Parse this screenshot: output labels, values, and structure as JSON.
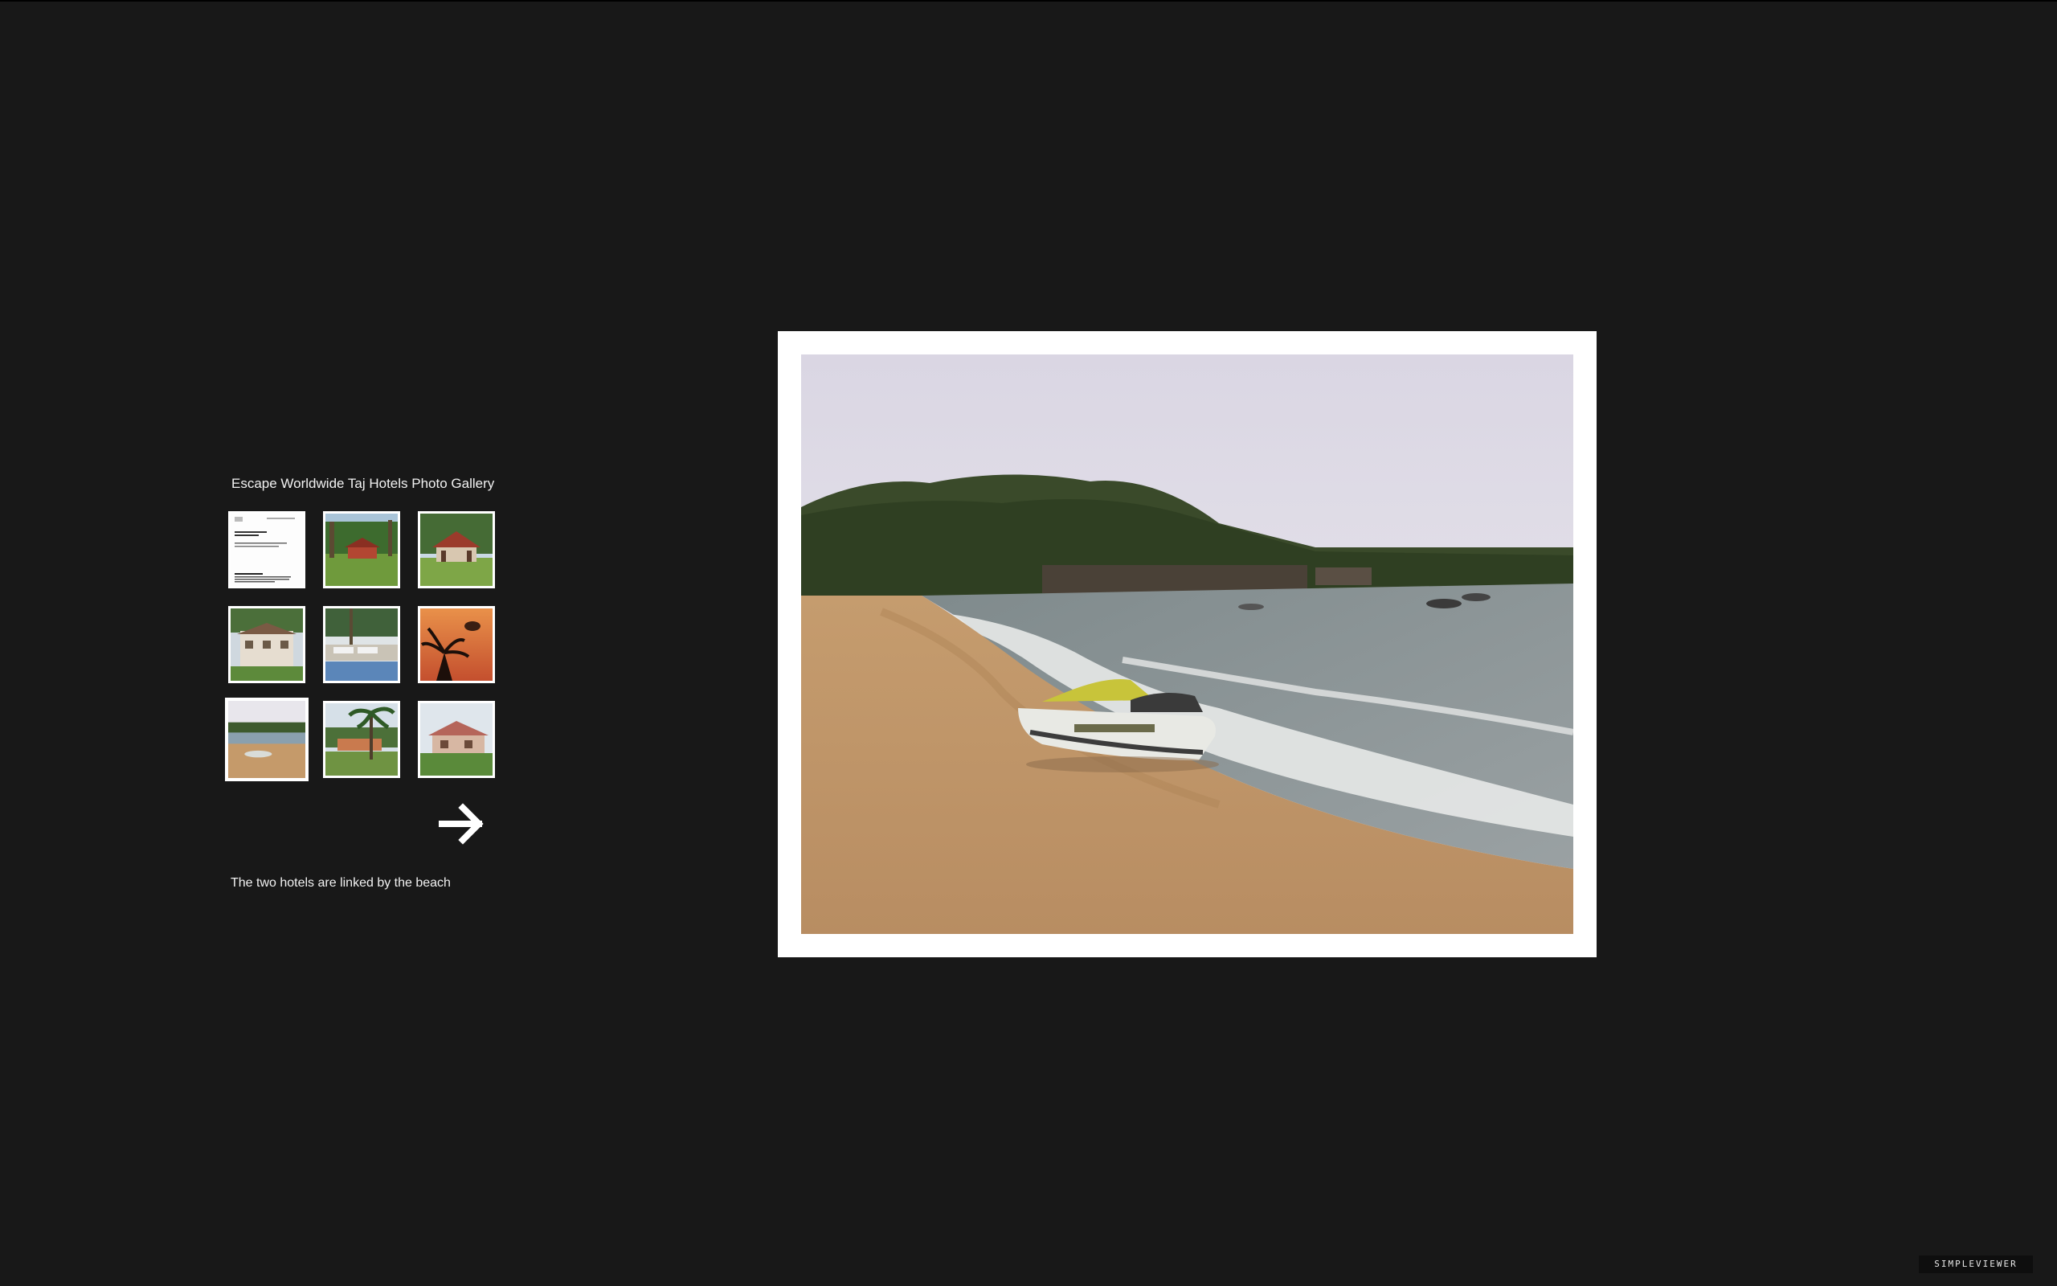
{
  "gallery": {
    "title": "Escape Worldwide Taj Hotels Photo Gallery",
    "thumbnails": [
      {
        "name": "thumb-document"
      },
      {
        "name": "thumb-red-house-lawn"
      },
      {
        "name": "thumb-pavilion-garden"
      },
      {
        "name": "thumb-villa-palms"
      },
      {
        "name": "thumb-pool-loungers"
      },
      {
        "name": "thumb-sunset-parasail"
      },
      {
        "name": "thumb-beach-jetski",
        "selected": true
      },
      {
        "name": "thumb-resort-palms"
      },
      {
        "name": "thumb-cottage-garden"
      }
    ],
    "next_icon": "arrow-right-icon",
    "caption": "The two hotels are linked by the beach"
  },
  "main_photo": {
    "subject": "beach-jetski"
  },
  "branding": {
    "label": "SIMPLEVIEWER"
  },
  "colors": {
    "background": "#181818",
    "frame": "#ffffff",
    "text": "#f2f2f2"
  }
}
